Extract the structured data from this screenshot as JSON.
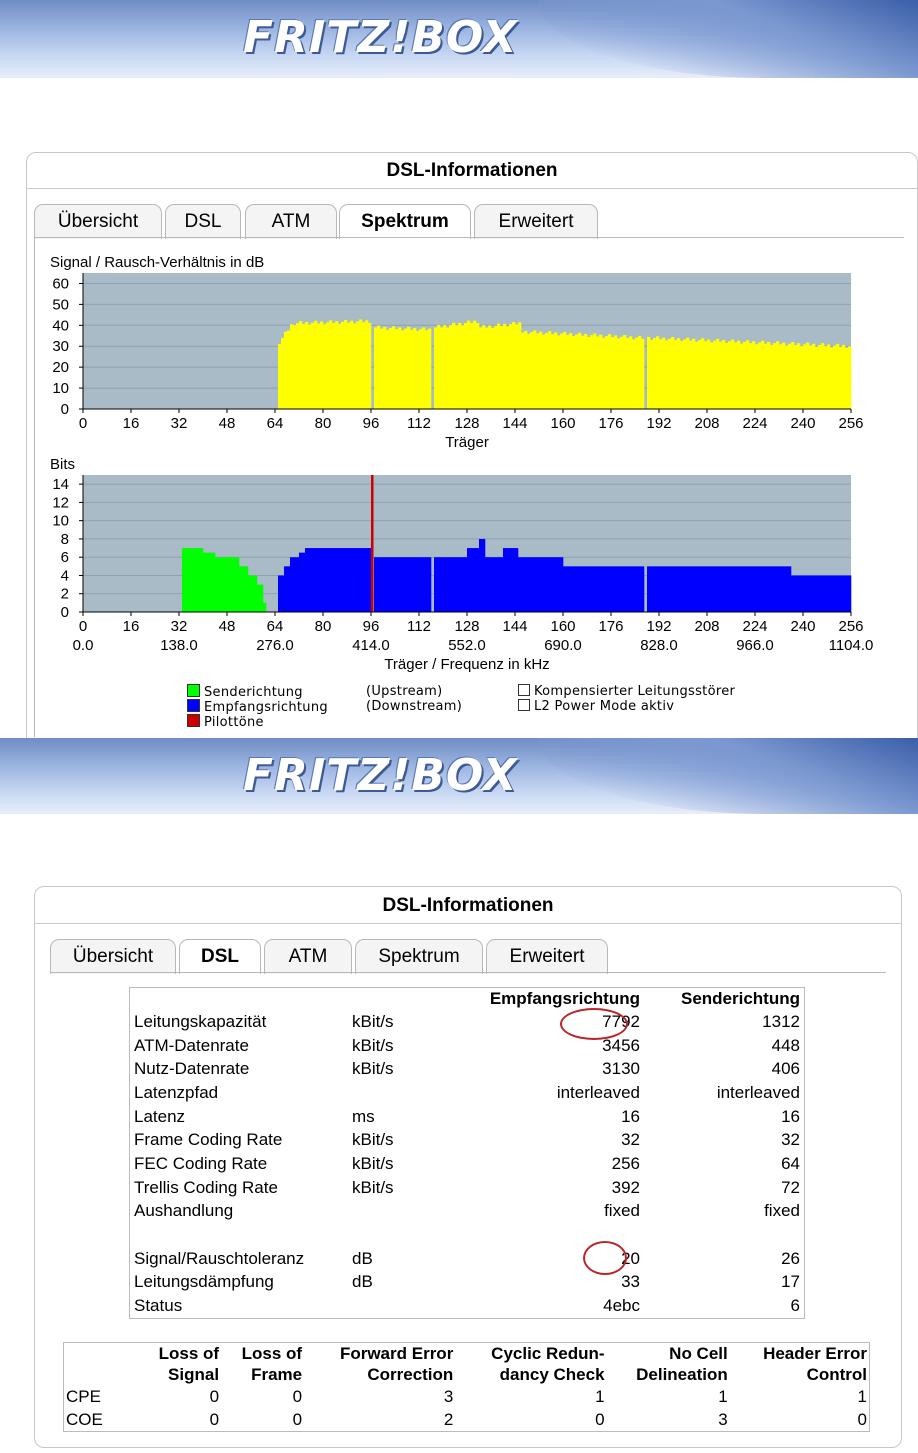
{
  "logo": "FRITZ!BOX",
  "panel_title": "DSL-Informationen",
  "tabs_top": [
    "Übersicht",
    "DSL",
    "ATM",
    "Spektrum",
    "Erweitert"
  ],
  "tabs_bottom": [
    "Übersicht",
    "DSL",
    "ATM",
    "Spektrum",
    "Erweitert"
  ],
  "colors": {
    "upstream": "#00ff00",
    "downstream": "#0000ff",
    "pilot": "#cc0000",
    "snr": "#ffff00",
    "plot_bg": "#a9bbc6"
  },
  "chart_data": [
    {
      "type": "bar",
      "title": "Signal / Rausch-Verhältnis in dB",
      "xlabel": "Träger",
      "ylabel": "",
      "xlim": [
        0,
        256
      ],
      "ylim": [
        0,
        65
      ],
      "yticks": [
        "0",
        "10",
        "20",
        "30",
        "40",
        "50",
        "60"
      ],
      "xticks": [
        "0",
        "16",
        "32",
        "48",
        "64",
        "80",
        "96",
        "112",
        "128",
        "144",
        "160",
        "176",
        "192",
        "208",
        "224",
        "240",
        "256"
      ],
      "grid": true,
      "segments": [
        {
          "x0": 65,
          "x1": 70,
          "y0": 32,
          "y1": 40
        },
        {
          "x0": 70,
          "x1": 96,
          "y0": 41,
          "y1": 42
        },
        {
          "x0": 97,
          "x1": 116,
          "y0": 39,
          "y1": 38
        },
        {
          "x0": 117,
          "x1": 132,
          "y0": 39,
          "y1": 42
        },
        {
          "x0": 132,
          "x1": 146,
          "y0": 39,
          "y1": 41
        },
        {
          "x0": 146,
          "x1": 187,
          "y0": 37,
          "y1": 34
        },
        {
          "x0": 188,
          "x1": 256,
          "y0": 34,
          "y1": 30
        }
      ]
    },
    {
      "type": "bar",
      "title": "Bits",
      "xlabel": "Träger / Frequenz in kHz",
      "ylabel": "",
      "xlim": [
        0,
        256
      ],
      "ylim": [
        0,
        15
      ],
      "yticks": [
        "0",
        "2",
        "4",
        "6",
        "8",
        "10",
        "12",
        "14"
      ],
      "xticks": [
        "0",
        "16",
        "32",
        "48",
        "64",
        "80",
        "96",
        "112",
        "128",
        "144",
        "160",
        "176",
        "192",
        "208",
        "224",
        "240",
        "256"
      ],
      "freq_ticks": [
        "0.0",
        "138.0",
        "276.0",
        "414.0",
        "552.0",
        "690.0",
        "828.0",
        "966.0",
        "1104.0"
      ],
      "grid": true,
      "series": [
        {
          "name": "Senderichtung",
          "segments": [
            {
              "x0": 33,
              "x1": 40,
              "v": 7
            },
            {
              "x0": 40,
              "x1": 44,
              "v": 6.5
            },
            {
              "x0": 44,
              "x1": 52,
              "v": 6
            },
            {
              "x0": 52,
              "x1": 55,
              "v": 5
            },
            {
              "x0": 55,
              "x1": 58,
              "v": 4
            },
            {
              "x0": 58,
              "x1": 60,
              "v": 3
            },
            {
              "x0": 60,
              "x1": 61,
              "v": 1
            }
          ]
        },
        {
          "name": "Empfangsrichtung",
          "segments": [
            {
              "x0": 65,
              "x1": 67,
              "v": 4
            },
            {
              "x0": 67,
              "x1": 69,
              "v": 5
            },
            {
              "x0": 69,
              "x1": 72,
              "v": 6
            },
            {
              "x0": 72,
              "x1": 74,
              "v": 6.5
            },
            {
              "x0": 74,
              "x1": 82,
              "v": 7
            },
            {
              "x0": 82,
              "x1": 96,
              "v": 7
            },
            {
              "x0": 97,
              "x1": 116,
              "v": 6
            },
            {
              "x0": 117,
              "x1": 128,
              "v": 6
            },
            {
              "x0": 128,
              "x1": 132,
              "v": 7
            },
            {
              "x0": 132,
              "x1": 134,
              "v": 8
            },
            {
              "x0": 134,
              "x1": 140,
              "v": 6
            },
            {
              "x0": 140,
              "x1": 145,
              "v": 7
            },
            {
              "x0": 145,
              "x1": 160,
              "v": 6
            },
            {
              "x0": 160,
              "x1": 187,
              "v": 5
            },
            {
              "x0": 188,
              "x1": 208,
              "v": 5
            },
            {
              "x0": 208,
              "x1": 236,
              "v": 5
            },
            {
              "x0": 236,
              "x1": 256,
              "v": 4
            }
          ]
        },
        {
          "name": "Pilottöne",
          "segments": [
            {
              "x0": 96,
              "x1": 97,
              "v": 15
            }
          ]
        }
      ]
    }
  ],
  "legend": {
    "upstream": "Senderichtung",
    "upstream_note": "(Upstream)",
    "downstream": "Empfangsrichtung",
    "downstream_note": "(Downstream)",
    "pilot": "Pilottöne",
    "check1": "Kompensierter Leitungsstörer",
    "check2": "L2 Power Mode aktiv"
  },
  "dsl_table": {
    "head_rx": "Empfangsrichtung",
    "head_tx": "Senderichtung",
    "rows": [
      {
        "label": "Leitungskapazität",
        "unit": "kBit/s",
        "rx": "7792",
        "tx": "1312"
      },
      {
        "label": "ATM-Datenrate",
        "unit": "kBit/s",
        "rx": "3456",
        "tx": "448"
      },
      {
        "label": "Nutz-Datenrate",
        "unit": "kBit/s",
        "rx": "3130",
        "tx": "406"
      },
      {
        "label": "Latenzpfad",
        "unit": "",
        "rx": "interleaved",
        "tx": "interleaved"
      },
      {
        "label": "Latenz",
        "unit": "ms",
        "rx": "16",
        "tx": "16"
      },
      {
        "label": "Frame Coding Rate",
        "unit": "kBit/s",
        "rx": "32",
        "tx": "32"
      },
      {
        "label": "FEC Coding Rate",
        "unit": "kBit/s",
        "rx": "256",
        "tx": "64"
      },
      {
        "label": "Trellis Coding Rate",
        "unit": "kBit/s",
        "rx": "392",
        "tx": "72"
      },
      {
        "label": "Aushandlung",
        "unit": "",
        "rx": "fixed",
        "tx": "fixed"
      },
      {
        "label": "",
        "unit": "",
        "rx": "",
        "tx": ""
      },
      {
        "label": "Signal/Rauschtoleranz",
        "unit": "dB",
        "rx": "20",
        "tx": "26"
      },
      {
        "label": "Leitungsdämpfung",
        "unit": "dB",
        "rx": "33",
        "tx": "17"
      },
      {
        "label": "Status",
        "unit": "",
        "rx": "4ebc",
        "tx": "6"
      }
    ]
  },
  "error_table": {
    "headers": [
      [
        "Loss of",
        "Signal"
      ],
      [
        "Loss of",
        "Frame"
      ],
      [
        "Forward Error",
        "Correction"
      ],
      [
        "Cyclic Redun-",
        "dancy Check"
      ],
      [
        "No Cell",
        "Delineation"
      ],
      [
        "Header Error",
        "Control"
      ]
    ],
    "rows": [
      {
        "label": "CPE",
        "values": [
          "0",
          "0",
          "3",
          "1",
          "1",
          "1"
        ]
      },
      {
        "label": "COE",
        "values": [
          "0",
          "0",
          "2",
          "0",
          "3",
          "0"
        ]
      }
    ]
  }
}
